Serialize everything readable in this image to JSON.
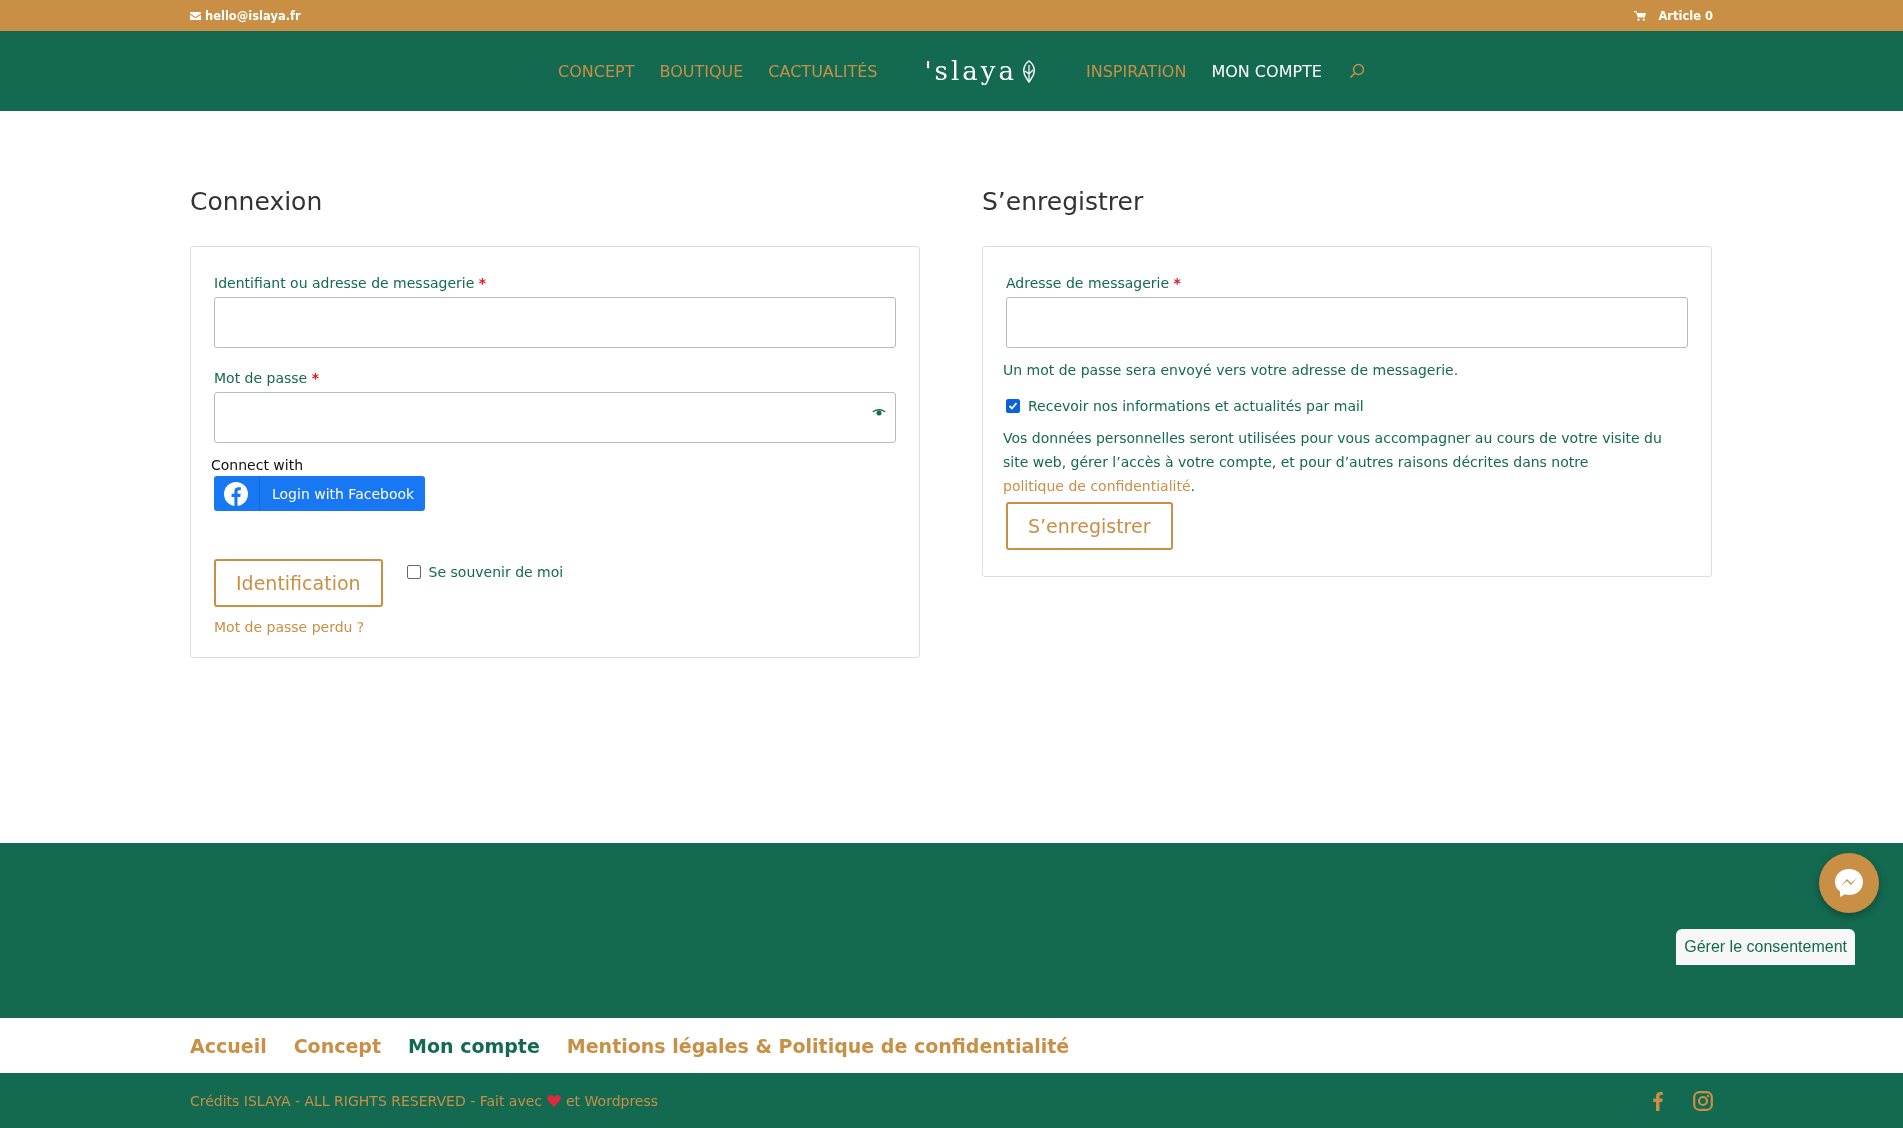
{
  "top_bar": {
    "email": "hello@islaya.fr",
    "cart": "Article 0"
  },
  "nav": {
    "left": [
      {
        "label": "CONCEPT",
        "selected": false
      },
      {
        "label": "BOUTIQUE",
        "selected": false
      },
      {
        "label": "CACTUALITÉS",
        "selected": false
      }
    ],
    "logo": "'slaya",
    "right": [
      {
        "label": "INSPIRATION",
        "selected": false
      },
      {
        "label": "MON COMPTE",
        "selected": true
      }
    ]
  },
  "login": {
    "title": "Connexion",
    "username_label": "Identifiant ou adresse de messagerie",
    "password_label": "Mot de passe",
    "required": "*",
    "connect_with": "Connect with",
    "facebook_button": "Login with Facebook",
    "submit": "Identification",
    "remember": {
      "label": "Se souvenir de moi",
      "checked": false
    },
    "lost_password": "Mot de passe perdu ?"
  },
  "register": {
    "title": "S’enregistrer",
    "email_label": "Adresse de messagerie",
    "required": "*",
    "note": "Un mot de passe sera envoyé vers votre adresse de messagerie.",
    "newsletter": {
      "label": "Recevoir nos informations et actualités par mail",
      "checked": true
    },
    "privacy_text": "Vos données personnelles seront utilisées pour vous accompagner au cours de votre visite du site web, gérer l’accès à votre compte, et pour d’autres raisons décrites dans notre",
    "privacy_link": "politique de confidentialité",
    "privacy_end": ".",
    "submit": "S’enregistrer"
  },
  "consent_button": "Gérer le consentement",
  "footer_menu": [
    {
      "label": "Accueil",
      "selected": false
    },
    {
      "label": "Concept",
      "selected": false
    },
    {
      "label": "Mon compte",
      "selected": true
    },
    {
      "label": "Mentions légales & Politique de confidentialité",
      "selected": false
    }
  ],
  "credits": {
    "before": "Crédits ISLAYA - ALL RIGHTS RESERVED - Fait avec",
    "after": "et Wordpress"
  }
}
